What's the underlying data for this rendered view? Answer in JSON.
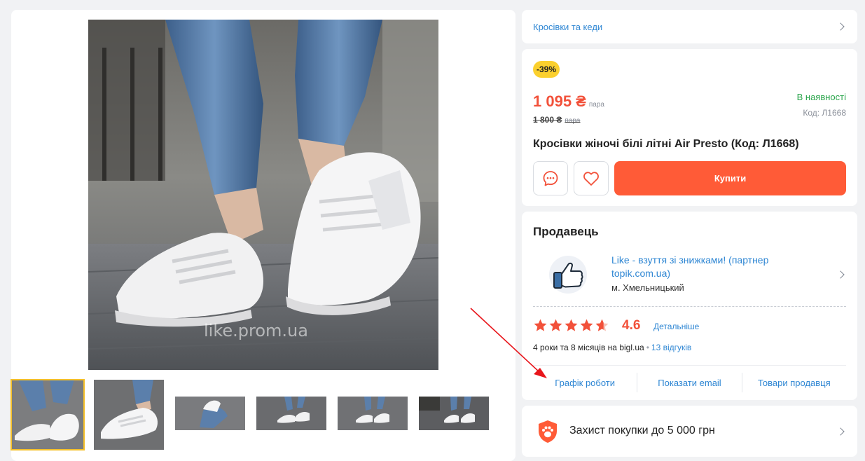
{
  "gallery": {
    "watermark": "like.prom.ua",
    "thumbnail_count": 6,
    "active_thumbnail": 1
  },
  "category": {
    "label": "Кросівки та кеди"
  },
  "product": {
    "discount": "-39%",
    "price": "1 095 ₴",
    "price_unit": "пара",
    "old_price": "1 800 ₴",
    "old_price_unit": "пара",
    "stock": "В наявності",
    "code": "Код: Л1668",
    "title": "Кросівки жіночі білі літні Air Presto (Код: Л1668)",
    "buy_label": "Купити"
  },
  "seller": {
    "heading": "Продавець",
    "name": "Like - взуття зі знижками! (партнер topik.com.ua)",
    "city": "м. Хмельницький",
    "rating": "4.6",
    "rating_value": 4.6,
    "details_label": "Детальніше",
    "since": "4 роки та 8 місяців на bigl.ua",
    "reviews": "13 відгуків",
    "links": {
      "schedule": "Графік роботи",
      "email": "Показати email",
      "products": "Товари продавця"
    }
  },
  "protection": {
    "label": "Захист покупки до 5 000 грн"
  },
  "colors": {
    "price": "#f2513a",
    "buy_button": "#ff5b37",
    "link": "#2e86d3",
    "in_stock": "#2aa54b",
    "discount_badge": "#fbd02e",
    "annotation_arrow": "#e8161c"
  }
}
